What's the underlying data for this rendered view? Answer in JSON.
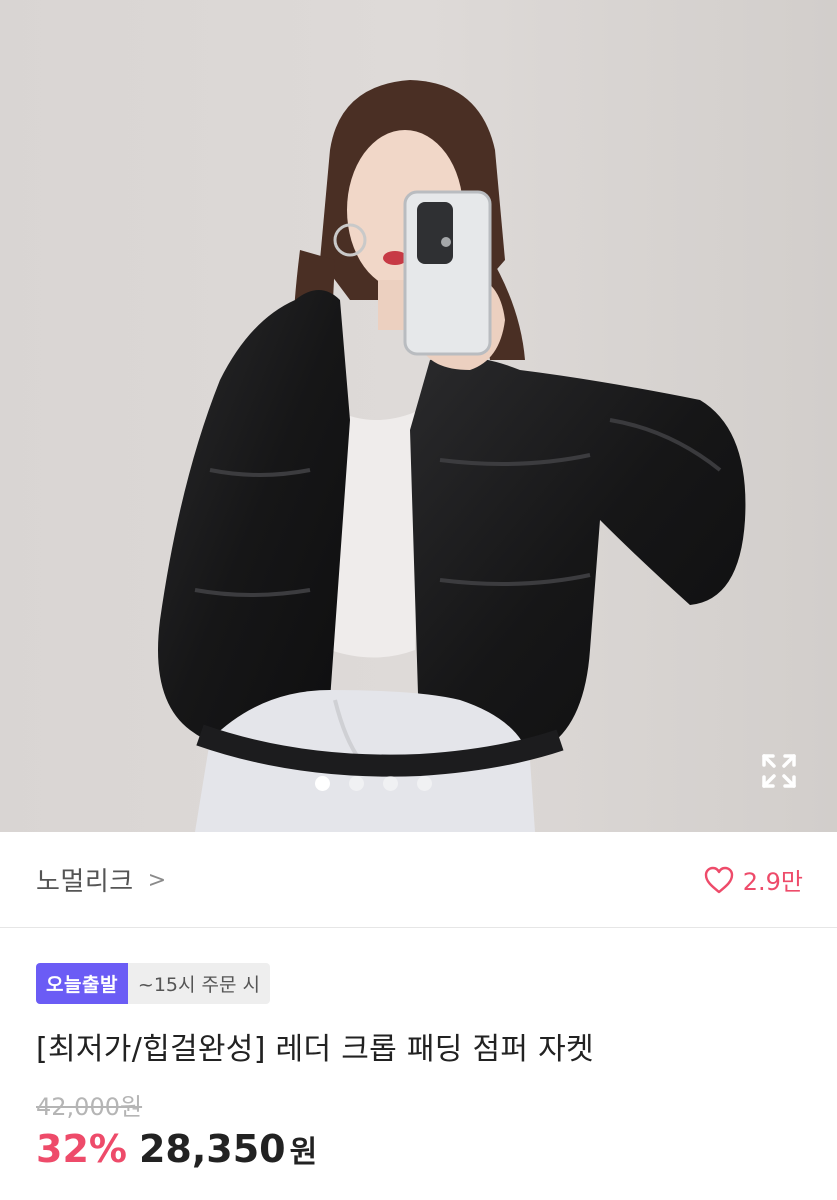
{
  "product": {
    "image_alt": "product photo",
    "gallery": {
      "current_index": 1,
      "total": 4
    }
  },
  "brand": {
    "name": "노멀리크",
    "chevron": ">"
  },
  "like": {
    "icon": "heart-outline-icon",
    "count": "2.9만"
  },
  "badges": {
    "primary": "오늘출발",
    "secondary": "~15시 주문 시"
  },
  "title": "[최저가/힙걸완성] 레더 크롭 패딩 점퍼 자켓",
  "price": {
    "original": "42,000원",
    "discount": "32%",
    "sale": "28,350",
    "unit": "원"
  },
  "colors": {
    "accent_pink": "#ee4b6a",
    "badge_purple": "#6b5cf5"
  }
}
